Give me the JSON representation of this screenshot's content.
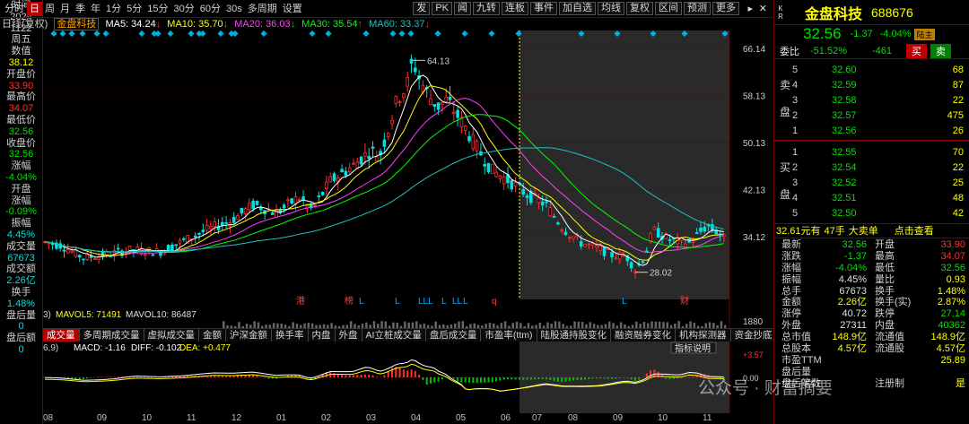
{
  "period_bar": {
    "items": [
      "分时",
      "日",
      "周",
      "月",
      "季",
      "年",
      "1分",
      "5分",
      "15分",
      "30分",
      "60分",
      "30s",
      "多周期",
      "设置"
    ],
    "active": "日"
  },
  "top_buttons": [
    "发",
    "PK",
    "闻",
    "九转",
    "连板",
    "事件",
    "加自选",
    "均线",
    "复权",
    "区间",
    "预测",
    "更多"
  ],
  "ma_legend": {
    "name": "日线(复权)",
    "stock": "金盘科技",
    "ma5": "MA5: 34.24",
    "ma10": "MA10: 35.70",
    "ma20": "MA20: 36.03",
    "ma30": "MA30: 35.54",
    "ma60": "MA60: 33.37"
  },
  "left_panel": {
    "labels": [
      "时间",
      "2024",
      "1122",
      "周五",
      "数值",
      "38.12",
      "开盘价",
      "33.90",
      "最高价",
      "34.07",
      "最低价",
      "32.56",
      "收盘价",
      "32.56",
      "涨幅",
      "-4.04%",
      "开盘",
      "涨幅",
      "-0.09%",
      "振幅",
      "4.45%",
      "成交量",
      "67673",
      "成交额",
      "2.26亿",
      "换手",
      "1.48%",
      "盘后量",
      "0",
      "盘后额",
      "0"
    ],
    "colors": [
      "w",
      "w",
      "w",
      "w",
      "w",
      "y",
      "w",
      "r",
      "w",
      "r",
      "w",
      "g",
      "w",
      "g",
      "w",
      "g",
      "w",
      "w",
      "g",
      "w",
      "c",
      "w",
      "c",
      "w",
      "c",
      "w",
      "c",
      "w",
      "c",
      "w",
      "c"
    ]
  },
  "price_axis": [
    "66.14",
    "58.13",
    "50.13",
    "42.13",
    "34.12"
  ],
  "annotations": {
    "high": "64.13",
    "low": "28.02"
  },
  "markers": [
    "港",
    "榜",
    "L",
    "L",
    "LLL",
    "L",
    "LL",
    "L",
    "q",
    "L",
    "财"
  ],
  "volume_legend": {
    "mavol5": "MAVOL5: 71491",
    "mavol10": "MAVOL10: 86487",
    "prefix": "3)"
  },
  "volume_axis": "1880",
  "tabs": [
    "成交量",
    "多周期成交量",
    "虚拟成交量",
    "金额",
    "沪深金额",
    "换手率",
    "内盘",
    "外盘",
    "AI立桩成交量",
    "盘后成交量",
    "市盈率(ttm)",
    "陆股通持股变化",
    "融资融券变化",
    "机构探测器",
    "资金抄底"
  ],
  "macd_legend": {
    "prefix": "6,9)",
    "macd": "MACD: -1.16",
    "diff": "DIFF: -0.102",
    "dea": "DEA: +0.477",
    "explain": "指标说明"
  },
  "macd_axis": {
    "top": "+3.57",
    "zero": "0.00"
  },
  "x_axis": [
    "08",
    "09",
    "10",
    "11",
    "12",
    "01",
    "02",
    "03",
    "04",
    "05",
    "06",
    "07",
    "08",
    "09",
    "10",
    "11"
  ],
  "stock": {
    "name": "金盘科技",
    "code": "688676",
    "price": "32.56",
    "change": "-1.37",
    "pct": "-4.04%",
    "tag": "陆主",
    "webi_label": "委比",
    "webi": "-51.52%",
    "webc": "-461",
    "buy_btn": "买",
    "sell_btn": "卖"
  },
  "sell_side": {
    "label": [
      "卖",
      "盘"
    ],
    "rows": [
      {
        "n": "5",
        "p": "32.60",
        "v": "68"
      },
      {
        "n": "4",
        "p": "32.59",
        "v": "87"
      },
      {
        "n": "3",
        "p": "32.58",
        "v": "22"
      },
      {
        "n": "2",
        "p": "32.57",
        "v": "475"
      },
      {
        "n": "1",
        "p": "32.56",
        "v": "26"
      }
    ]
  },
  "buy_side": {
    "label": [
      "买",
      "盘"
    ],
    "rows": [
      {
        "n": "1",
        "p": "32.55",
        "v": "70"
      },
      {
        "n": "2",
        "p": "32.54",
        "v": "22"
      },
      {
        "n": "3",
        "p": "32.52",
        "v": "25"
      },
      {
        "n": "4",
        "p": "32.51",
        "v": "48"
      },
      {
        "n": "5",
        "p": "32.50",
        "v": "42"
      }
    ]
  },
  "quote_bar": {
    "price": "32.61元有",
    "count": "47手",
    "label": "大卖单",
    "link": "点击查看"
  },
  "stats": [
    [
      "最新",
      "32.56",
      "开盘",
      "33.90"
    ],
    [
      "涨跌",
      "-1.37",
      "最高",
      "34.07"
    ],
    [
      "涨幅",
      "-4.04%",
      "最低",
      "32.56"
    ],
    [
      "振幅",
      "4.45%",
      "量比",
      "0.93"
    ],
    [
      "总手",
      "67673",
      "换手",
      "1.48%"
    ],
    [
      "金额",
      "2.26亿",
      "换手(实)",
      "2.87%"
    ],
    [
      "涨停",
      "40.72",
      "跌停",
      "27.14"
    ],
    [
      "外盘",
      "27311",
      "内盘",
      "40362"
    ],
    [
      "总市值",
      "148.9亿",
      "流通值",
      "148.9亿"
    ],
    [
      "总股本",
      "4.57亿",
      "流通股",
      "4.57亿"
    ],
    [
      "市盈TTM",
      "",
      "",
      "25.89"
    ],
    [
      "盘后量",
      "",
      "",
      ""
    ],
    [
      "盘后笔数",
      "",
      "注册制",
      "是"
    ]
  ],
  "watermark": "公众号 · 财富摘要",
  "colors": {
    "bg": "#000000",
    "red": "#ff3030",
    "green": "#00e000",
    "ma5": "#ffffff",
    "ma10": "#ffff00",
    "ma20": "#ff40ff",
    "ma30": "#00ff00",
    "ma60": "#20c0c0",
    "border": "#7a0000"
  },
  "chart_data": {
    "type": "candlestick",
    "ylim": [
      24,
      68
    ],
    "ma_series": [
      "MA5",
      "MA10",
      "MA20",
      "MA30",
      "MA60"
    ],
    "high": 64.13,
    "low": 28.02,
    "waypoints": [
      [
        0,
        33.2
      ],
      [
        20,
        32.6
      ],
      [
        45,
        30.5
      ],
      [
        70,
        31.0
      ],
      [
        95,
        31.8
      ],
      [
        130,
        31.5
      ],
      [
        160,
        33.6
      ],
      [
        185,
        35.4
      ],
      [
        210,
        36.8
      ],
      [
        235,
        39.6
      ],
      [
        260,
        38.1
      ],
      [
        285,
        40.8
      ],
      [
        300,
        38.6
      ],
      [
        320,
        43.5
      ],
      [
        345,
        46.1
      ],
      [
        365,
        48.8
      ],
      [
        375,
        47.8
      ],
      [
        385,
        52.5
      ],
      [
        395,
        57.6
      ],
      [
        405,
        59.5
      ],
      [
        412,
        64.1
      ],
      [
        420,
        60.8
      ],
      [
        430,
        58.1
      ],
      [
        440,
        56.2
      ],
      [
        450,
        57.4
      ],
      [
        460,
        55.1
      ],
      [
        470,
        52.8
      ],
      [
        480,
        50.1
      ],
      [
        500,
        45.4
      ],
      [
        520,
        43.5
      ],
      [
        540,
        41.2
      ],
      [
        560,
        39.6
      ],
      [
        580,
        35.4
      ],
      [
        600,
        33.0
      ],
      [
        620,
        32.0
      ],
      [
        635,
        30.9
      ],
      [
        650,
        30.8
      ],
      [
        660,
        28.4
      ],
      [
        670,
        30.5
      ],
      [
        680,
        35.2
      ],
      [
        700,
        33.4
      ],
      [
        720,
        33.0
      ],
      [
        740,
        36.0
      ],
      [
        755,
        34.5
      ],
      [
        765,
        32.5
      ]
    ]
  }
}
